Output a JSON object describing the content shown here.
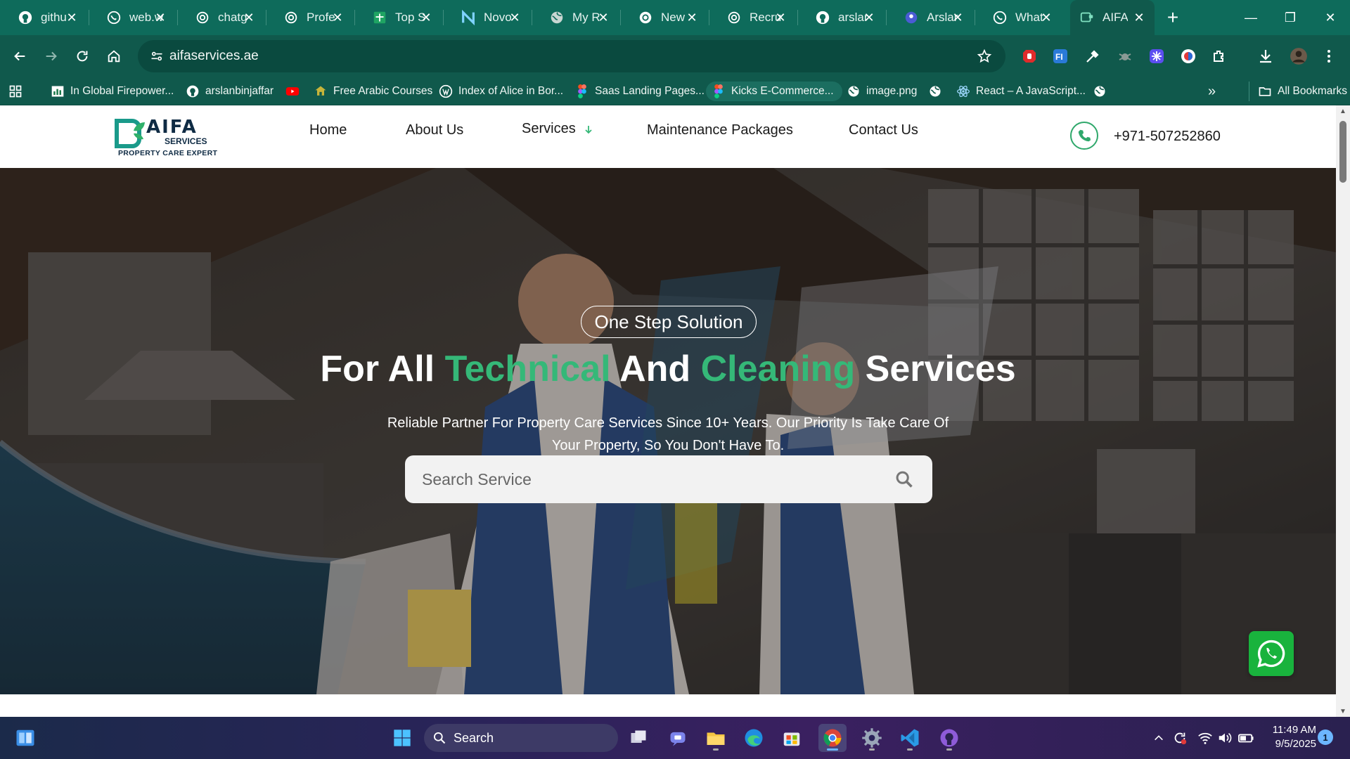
{
  "browser": {
    "tabs": [
      {
        "title": "githu",
        "icon": "github-icon"
      },
      {
        "title": "web.w",
        "icon": "whatsapp-icon"
      },
      {
        "title": "chatg",
        "icon": "openai-icon"
      },
      {
        "title": "Profe",
        "icon": "openai-icon"
      },
      {
        "title": "Top S",
        "icon": "sheets-icon"
      },
      {
        "title": "Novo",
        "icon": "novo-icon"
      },
      {
        "title": "My R",
        "icon": "globe-icon"
      },
      {
        "title": "New",
        "icon": "openai-icon"
      },
      {
        "title": "Recru",
        "icon": "openai-icon"
      },
      {
        "title": "arslar",
        "icon": "github-icon"
      },
      {
        "title": "Arslar",
        "icon": "profile-icon"
      },
      {
        "title": "What",
        "icon": "whatsapp-icon"
      },
      {
        "title": "AIFA",
        "icon": "site-icon",
        "active": true
      }
    ],
    "url": "aifaservices.ae",
    "bookmarks": [
      {
        "label": "In Global Firepower...",
        "icon": "chart-icon"
      },
      {
        "label": "arslanbinjaffar",
        "icon": "github-icon"
      },
      {
        "label": "",
        "icon": "youtube-icon"
      },
      {
        "label": "Free Arabic Courses",
        "icon": "course-icon"
      },
      {
        "label": "Index of Alice in Bor...",
        "icon": "wordpress-icon"
      },
      {
        "label": "Saas Landing Pages...",
        "icon": "figma-icon"
      },
      {
        "label": "Kicks E-Commerce...",
        "icon": "figma-icon"
      },
      {
        "label": "image.png",
        "icon": "globe-icon"
      },
      {
        "label": "",
        "icon": "globe-icon"
      },
      {
        "label": "React – A JavaScript...",
        "icon": "react-icon"
      },
      {
        "label": "",
        "icon": "globe-icon"
      }
    ],
    "all_bookmarks_label": "All Bookmarks"
  },
  "site": {
    "logo": {
      "name": "AIFA",
      "sub": "SERVICES",
      "tagline": "PROPERTY CARE EXPERT"
    },
    "nav": [
      "Home",
      "About Us",
      "Services",
      "Maintenance Packages",
      "Contact Us"
    ],
    "phone": "+971-507252860",
    "hero": {
      "pill": "One Step Solution",
      "headline_parts": [
        "For All ",
        "Technical",
        " And ",
        "Cleaning",
        " Services"
      ],
      "subtext": "Reliable Partner For Property Care Services Since 10+ Years. Our Priority Is Take Care Of Your Property, So You Don't Have To.",
      "search_placeholder": "Search Service"
    }
  },
  "taskbar": {
    "search_label": "Search",
    "time": "11:49 AM",
    "date": "9/5/2025",
    "notification_count": "1"
  },
  "colors": {
    "browser_frame": "#10594c",
    "accent_green": "#35b878",
    "whatsapp": "#19b33d"
  }
}
